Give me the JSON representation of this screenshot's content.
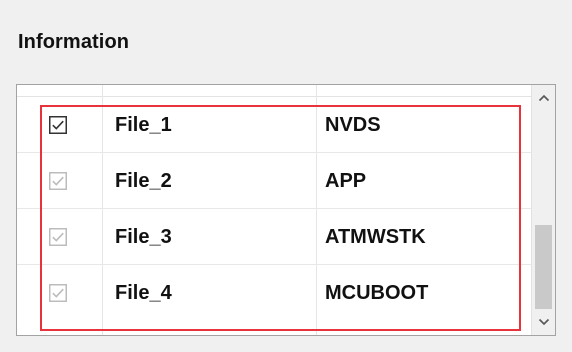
{
  "section": {
    "title": "Information"
  },
  "list": {
    "rows": [
      {
        "checked": true,
        "enabled": true,
        "name": "File_1",
        "type": "NVDS"
      },
      {
        "checked": true,
        "enabled": false,
        "name": "File_2",
        "type": "APP"
      },
      {
        "checked": true,
        "enabled": false,
        "name": "File_3",
        "type": "ATMWSTK"
      },
      {
        "checked": true,
        "enabled": false,
        "name": "File_4",
        "type": "MCUBOOT"
      }
    ]
  },
  "scrollbar": {
    "up_icon": "chevron-up-icon",
    "down_icon": "chevron-down-icon"
  },
  "colors": {
    "highlight": "#e8323c",
    "text": "#111111",
    "background": "#f0f0f0",
    "checkbox_enabled": "#333333",
    "checkbox_disabled": "#bcbcbc"
  }
}
